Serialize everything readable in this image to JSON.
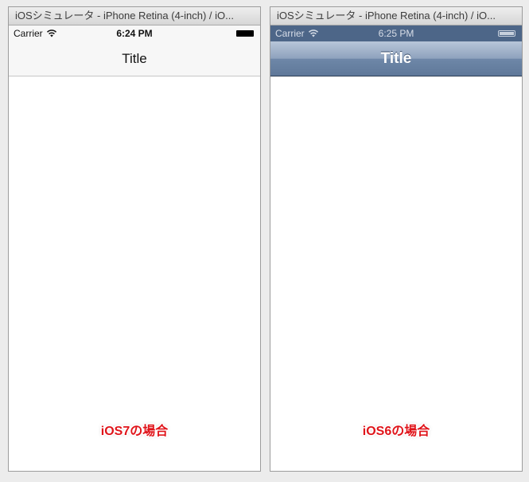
{
  "simulators": [
    {
      "window_title": "iOSシミュレータ - iPhone Retina (4-inch) / iO...",
      "carrier": "Carrier",
      "time": "6:24 PM",
      "nav_title": "Title",
      "caption": "iOS7の場合"
    },
    {
      "window_title": "iOSシミュレータ - iPhone Retina (4-inch) / iO...",
      "carrier": "Carrier",
      "time": "6:25 PM",
      "nav_title": "Title",
      "caption": "iOS6の場合"
    }
  ],
  "icons": {
    "wifi": "wifi-icon",
    "battery": "battery-icon"
  },
  "colors": {
    "caption": "#e0141a",
    "ios6_navbar": "#6e87a8",
    "ios6_statusbar": "#4d6688",
    "ios7_navbar": "#f7f7f7"
  }
}
